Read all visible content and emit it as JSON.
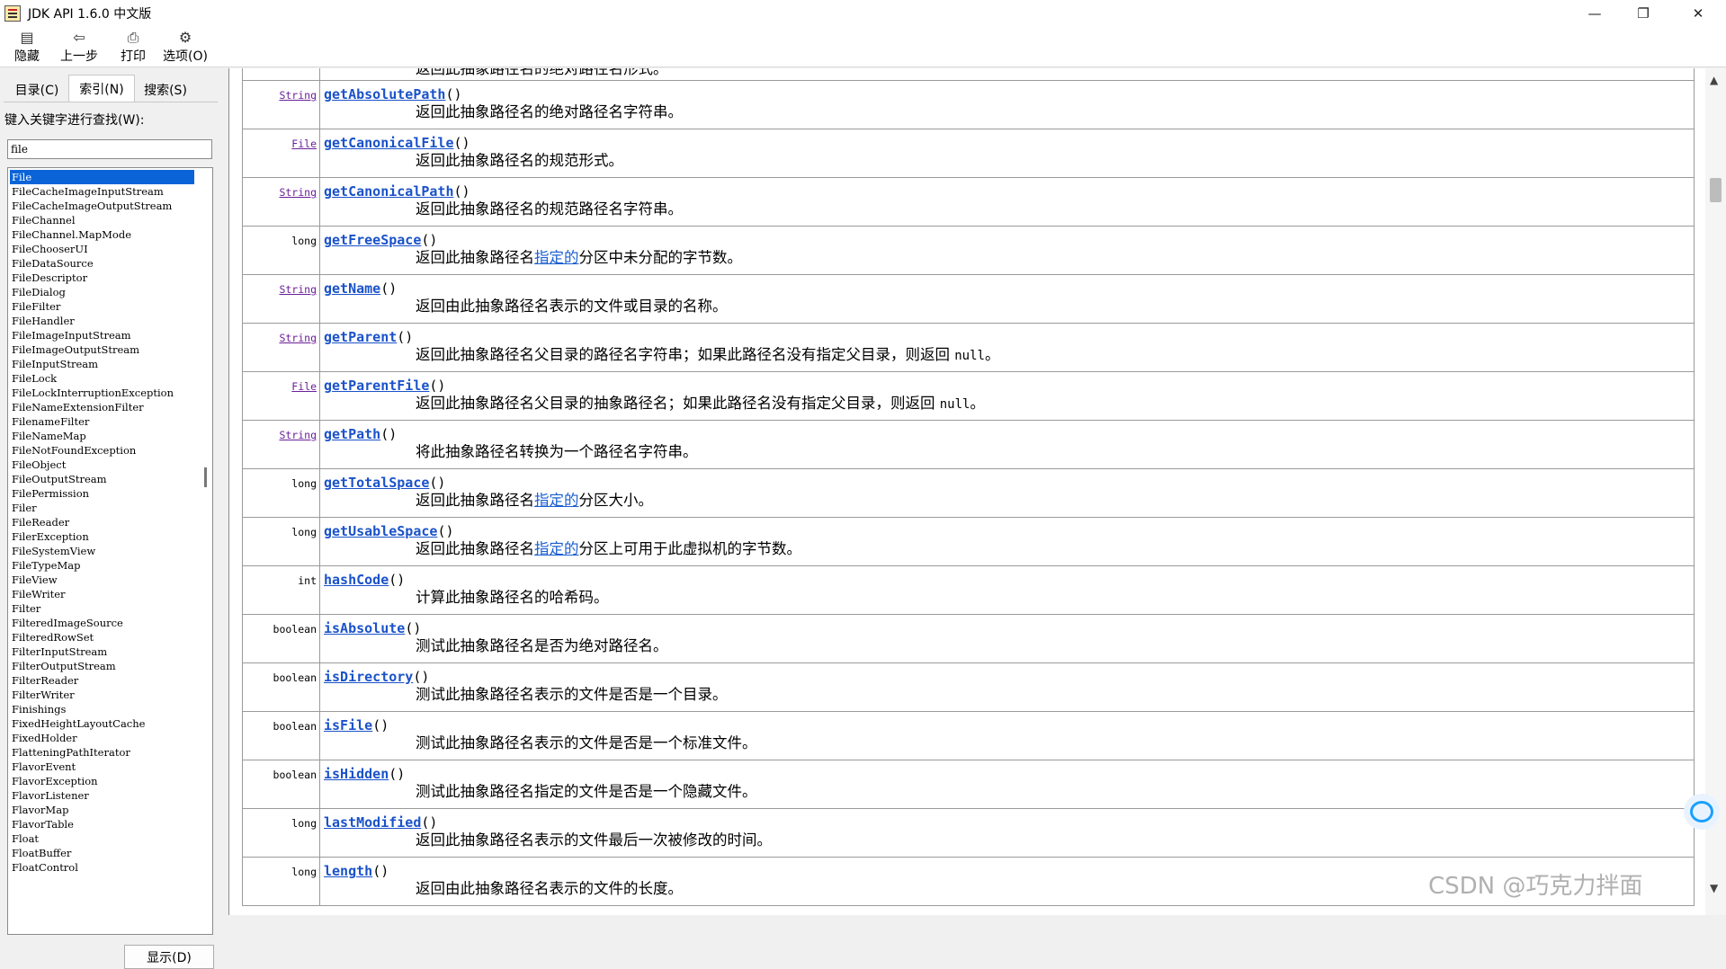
{
  "window": {
    "title": "JDK API 1.6.0 中文版",
    "minimize_glyph": "—",
    "maximize_glyph": "❐",
    "close_glyph": "✕"
  },
  "toolbar": {
    "hide_label": "隐藏",
    "back_label": "上一步",
    "print_label": "打印",
    "options_label": "选项(O)"
  },
  "tabs": {
    "contents": "目录(C)",
    "index": "索引(N)",
    "search": "搜索(S)"
  },
  "index_panel": {
    "keyword_label": "键入关键字进行查找(W):",
    "keyword_value": "file",
    "show_button": "显示(D)",
    "items": [
      "File",
      "FileCacheImageInputStream",
      "FileCacheImageOutputStream",
      "FileChannel",
      "FileChannel.MapMode",
      "FileChooserUI",
      "FileDataSource",
      "FileDescriptor",
      "FileDialog",
      "FileFilter",
      "FileHandler",
      "FileImageInputStream",
      "FileImageOutputStream",
      "FileInputStream",
      "FileLock",
      "FileLockInterruptionException",
      "FileNameExtensionFilter",
      "FilenameFilter",
      "FileNameMap",
      "FileNotFoundException",
      "FileObject",
      "FileOutputStream",
      "FilePermission",
      "Filer",
      "FileReader",
      "FilerException",
      "FileSystemView",
      "FileTypeMap",
      "FileView",
      "FileWriter",
      "Filter",
      "FilteredImageSource",
      "FilteredRowSet",
      "FilterInputStream",
      "FilterOutputStream",
      "FilterReader",
      "FilterWriter",
      "Finishings",
      "FixedHeightLayoutCache",
      "FixedHolder",
      "FlatteningPathIterator",
      "FlavorEvent",
      "FlavorException",
      "FlavorListener",
      "FlavorMap",
      "FlavorTable",
      "Float",
      "FloatBuffer",
      "FloatControl"
    ],
    "selected_index": 0
  },
  "methods": [
    {
      "type": "",
      "type_is_link": false,
      "name": "",
      "desc_parts": [
        {
          "t": "返回此抽象路径名的绝对路径名形式。"
        }
      ]
    },
    {
      "type": "String",
      "type_is_link": true,
      "name": "getAbsolutePath",
      "desc_parts": [
        {
          "t": "返回此抽象路径名的绝对路径名字符串。"
        }
      ]
    },
    {
      "type": "File",
      "type_is_link": true,
      "name": "getCanonicalFile",
      "desc_parts": [
        {
          "t": "返回此抽象路径名的规范形式。"
        }
      ]
    },
    {
      "type": "String",
      "type_is_link": true,
      "name": "getCanonicalPath",
      "desc_parts": [
        {
          "t": "返回此抽象路径名的规范路径名字符串。"
        }
      ]
    },
    {
      "type": "long",
      "type_is_link": false,
      "name": "getFreeSpace",
      "desc_parts": [
        {
          "t": "返回此抽象路径名"
        },
        {
          "t": "指定的",
          "link": true
        },
        {
          "t": "分区中未分配的字节数。"
        }
      ]
    },
    {
      "type": "String",
      "type_is_link": true,
      "name": "getName",
      "desc_parts": [
        {
          "t": "返回由此抽象路径名表示的文件或目录的名称。"
        }
      ]
    },
    {
      "type": "String",
      "type_is_link": true,
      "name": "getParent",
      "desc_parts": [
        {
          "t": "返回此抽象路径名父目录的路径名字符串；如果此路径名没有指定父目录，则返回 "
        },
        {
          "t": "null",
          "code": true
        },
        {
          "t": "。"
        }
      ]
    },
    {
      "type": "File",
      "type_is_link": true,
      "name": "getParentFile",
      "desc_parts": [
        {
          "t": "返回此抽象路径名父目录的抽象路径名；如果此路径名没有指定父目录，则返回 "
        },
        {
          "t": "null",
          "code": true
        },
        {
          "t": "。"
        }
      ]
    },
    {
      "type": "String",
      "type_is_link": true,
      "name": "getPath",
      "desc_parts": [
        {
          "t": "将此抽象路径名转换为一个路径名字符串。"
        }
      ]
    },
    {
      "type": "long",
      "type_is_link": false,
      "name": "getTotalSpace",
      "desc_parts": [
        {
          "t": "返回此抽象路径名"
        },
        {
          "t": "指定的",
          "link": true
        },
        {
          "t": "分区大小。"
        }
      ]
    },
    {
      "type": "long",
      "type_is_link": false,
      "name": "getUsableSpace",
      "desc_parts": [
        {
          "t": "返回此抽象路径名"
        },
        {
          "t": "指定的",
          "link": true
        },
        {
          "t": "分区上可用于此虚拟机的字节数。"
        }
      ]
    },
    {
      "type": "int",
      "type_is_link": false,
      "name": "hashCode",
      "desc_parts": [
        {
          "t": "计算此抽象路径名的哈希码。"
        }
      ]
    },
    {
      "type": "boolean",
      "type_is_link": false,
      "name": "isAbsolute",
      "desc_parts": [
        {
          "t": "测试此抽象路径名是否为绝对路径名。"
        }
      ]
    },
    {
      "type": "boolean",
      "type_is_link": false,
      "name": "isDirectory",
      "desc_parts": [
        {
          "t": "测试此抽象路径名表示的文件是否是一个目录。"
        }
      ]
    },
    {
      "type": "boolean",
      "type_is_link": false,
      "name": "isFile",
      "desc_parts": [
        {
          "t": "测试此抽象路径名表示的文件是否是一个标准文件。"
        }
      ]
    },
    {
      "type": "boolean",
      "type_is_link": false,
      "name": "isHidden",
      "desc_parts": [
        {
          "t": "测试此抽象路径名指定的文件是否是一个隐藏文件。"
        }
      ]
    },
    {
      "type": "long",
      "type_is_link": false,
      "name": "lastModified",
      "desc_parts": [
        {
          "t": "返回此抽象路径名表示的文件最后一次被修改的时间。"
        }
      ]
    },
    {
      "type": "long",
      "type_is_link": false,
      "name": "length",
      "desc_parts": [
        {
          "t": "返回由此抽象路径名表示的文件的长度。"
        }
      ]
    }
  ],
  "watermark": "CSDN @巧克力拌面",
  "colors": {
    "method_link": "#1a52c9",
    "type_link": "#6b1f9a",
    "selection": "#0a64d8"
  }
}
